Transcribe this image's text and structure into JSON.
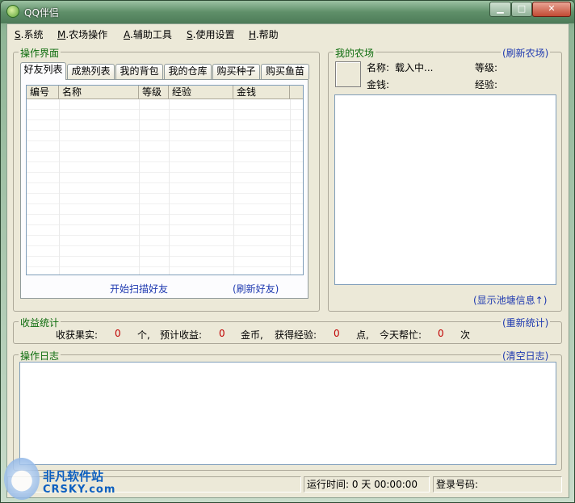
{
  "window": {
    "title": "QQ伴侣",
    "min_label": "▁",
    "max_label": "□",
    "close_label": "✕"
  },
  "menu": [
    {
      "key": "S",
      "label": ".系统"
    },
    {
      "key": "M",
      "label": ".农场操作"
    },
    {
      "key": "A",
      "label": ".辅助工具"
    },
    {
      "key": "S",
      "label": ".使用设置"
    },
    {
      "key": "H",
      "label": ".帮助"
    }
  ],
  "operation_panel": {
    "title": "操作界面",
    "tabs": [
      "好友列表",
      "成熟列表",
      "我的背包",
      "我的仓库",
      "购买种子",
      "购买鱼苗"
    ],
    "columns": [
      "编号",
      "名称",
      "等级",
      "经验",
      "金钱"
    ],
    "start_scan": "开始扫描好友",
    "refresh_friends": "(刷新好友)"
  },
  "my_farm": {
    "title": "我的农场",
    "refresh_link": "(刷新农场)",
    "name_label": "名称:",
    "name_value": "载入中...",
    "level_label": "等级:",
    "money_label": "金钱:",
    "exp_label": "经验:",
    "show_pond": "(显示池塘信息↑)"
  },
  "income": {
    "title": "收益统计",
    "recount": "(重新统计)",
    "harvest_label": "收获果实:",
    "harvest_value": "0",
    "harvest_unit": "个,",
    "expected_label": "预计收益:",
    "expected_value": "0",
    "expected_unit": "金币,",
    "exp_label": "获得经验:",
    "exp_value": "0",
    "exp_unit": "点,",
    "help_label": "今天帮忙:",
    "help_value": "0",
    "help_unit": "次"
  },
  "log": {
    "title": "操作日志",
    "clear": "(清空日志)"
  },
  "status": {
    "runtime": "运行时间: 0 天 00:00:00",
    "login": "登录号码:"
  },
  "watermark": {
    "cn": "非凡软件站",
    "en": "CRSKY.com"
  }
}
